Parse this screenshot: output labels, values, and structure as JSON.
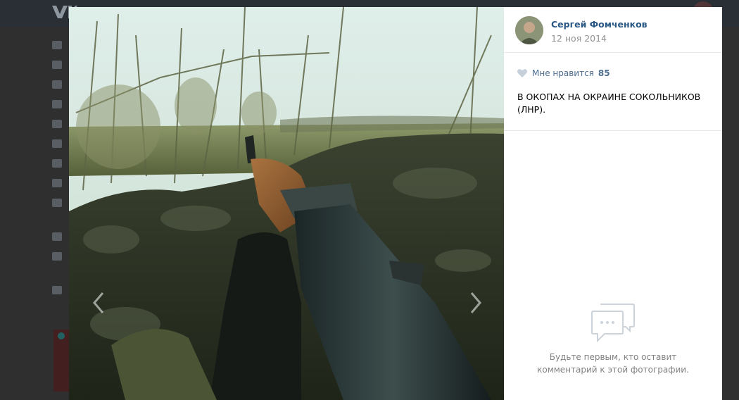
{
  "background": {
    "logo": "VK"
  },
  "viewer": {
    "author": {
      "name": "Сергей Фомченков",
      "date": "12 ноя 2014"
    },
    "likes": {
      "label": "Мне нравится",
      "count": "85",
      "icon": "heart-icon"
    },
    "caption": "В ОКОПАХ НА ОКРАИНЕ СОКОЛЬНИКОВ (ЛНР).",
    "comments_empty": "Будьте первым, кто оставит комментарий к этой фотографии.",
    "nav": {
      "prev_icon": "chevron-left-icon",
      "next_icon": "chevron-right-icon"
    }
  },
  "colors": {
    "link": "#2a5885",
    "muted": "#939393",
    "like": "#4d6d8f"
  }
}
